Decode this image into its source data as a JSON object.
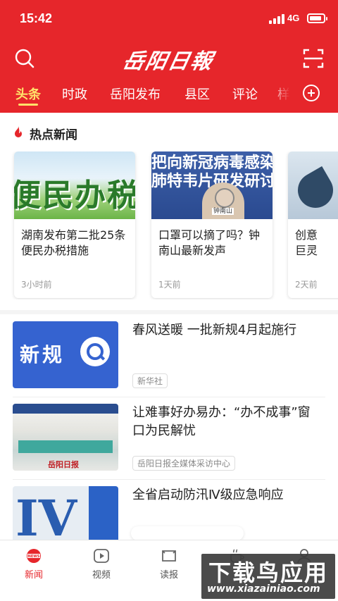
{
  "status_bar": {
    "time": "15:42",
    "network": "4G"
  },
  "header": {
    "logo_text": "岳阳日報",
    "channels": [
      "头条",
      "时政",
      "岳阳发布",
      "县区",
      "评论",
      "样"
    ],
    "active_channel": "头条"
  },
  "hot_news": {
    "title": "热点新闻",
    "cards": [
      {
        "thumb_text": "便民办税",
        "title": "湖南发布第二批25条便民办税措施",
        "time": "3小时前"
      },
      {
        "thumb_text": "把向新冠病毒感染\n肺特韦片研发研讨",
        "thumb_caption": "钟南山",
        "title": "口罩可以摘了吗？钟南山最新发声",
        "time": "1天前"
      },
      {
        "title": "创意巨灵",
        "time": "2天前"
      }
    ]
  },
  "news": [
    {
      "thumb_text": "新规",
      "title": "春风送暖 一批新规4月起施行",
      "source": "新华社"
    },
    {
      "thumb_text": "岳阳日报",
      "title": "让难事好办易办：“办不成事”窗口为民解忧",
      "source": "岳阳日报全媒体采访中心"
    },
    {
      "thumb_text": "IV",
      "title": "全省启动防汛Ⅳ级应急响应"
    }
  ],
  "tabbar": {
    "items": [
      {
        "label": "新闻",
        "icon": "news-icon",
        "active": true
      },
      {
        "label": "视频",
        "icon": "video-play-icon"
      },
      {
        "label": "读报",
        "icon": "newspaper-icon"
      },
      {
        "label": "",
        "icon": "cup-icon"
      },
      {
        "label": "",
        "icon": "user-icon"
      }
    ]
  },
  "watermark": {
    "main": "下载鸟应用",
    "url": "www.xiazainiao.com"
  },
  "colors": {
    "brand_red": "#e6262b",
    "active_channel": "#ffe26a"
  }
}
